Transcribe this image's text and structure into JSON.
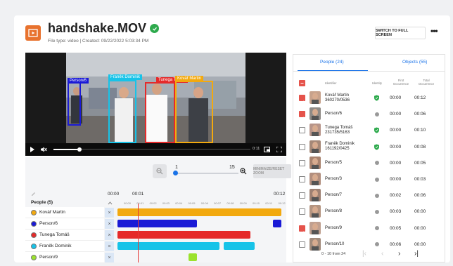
{
  "header": {
    "title": "handshake.MOV",
    "subtitle": "File type: video | Created: 09/22/2022 5:03:34 PM",
    "switch_label": "SWITCH TO FULL SCREEN",
    "more_icon": "more-icon"
  },
  "video": {
    "boxes": [
      {
        "label": "Person/6",
        "color": "#1a1ad6"
      },
      {
        "label": "Franěk Dominik",
        "color": "#17c3e8"
      },
      {
        "label": "Tunega Tomáš",
        "color": "#e52a2a"
      },
      {
        "label": "Kovář Martin",
        "color": "#f2a90f"
      }
    ],
    "time_display": "0:11"
  },
  "timeline": {
    "zoom_min": "1",
    "zoom_max": "15",
    "reset_label": "MINIMAIZE/RESET ZOOM",
    "start_time": "00:00",
    "playhead_time": "00:01",
    "end_time": "00:12",
    "section_label": "People (5)",
    "ticks": [
      "00:00",
      "00:01",
      "00:02",
      "00:03",
      "00:04",
      "00:05",
      "00:06",
      "00:07",
      "00:08",
      "00:09",
      "00:10",
      "00:11",
      "00:12"
    ],
    "rows": [
      {
        "name": "Kovář Martin",
        "color": "#f2a90f"
      },
      {
        "name": "Person/6",
        "color": "#1a1ad6"
      },
      {
        "name": "Tunega Tomáš",
        "color": "#e52a2a"
      },
      {
        "name": "Franěk Dominik",
        "color": "#17c3e8"
      },
      {
        "name": "Person/9",
        "color": "#9be22d"
      }
    ]
  },
  "panel": {
    "tabs": [
      "People (24)",
      "Objects (55)"
    ],
    "columns": [
      "Identifier",
      "Identity",
      "First Occurrence",
      "Total Occurrence"
    ],
    "rows": [
      {
        "id": "Kovář Martin 360270/0536",
        "identity": "verified",
        "first": "00:00",
        "total": "00:12",
        "checked": true
      },
      {
        "id": "Person/6",
        "identity": "unknown",
        "first": "00:00",
        "total": "00:06",
        "checked": true
      },
      {
        "id": "Tunega Tomáš 231735/5163",
        "identity": "verified",
        "first": "00:00",
        "total": "00:10",
        "checked": false
      },
      {
        "id": "Franěk Dominik 161192/0425",
        "identity": "verified",
        "first": "00:00",
        "total": "00:08",
        "checked": false
      },
      {
        "id": "Person/5",
        "identity": "unknown",
        "first": "00:00",
        "total": "00:05",
        "checked": false
      },
      {
        "id": "Person/3",
        "identity": "unknown",
        "first": "00:00",
        "total": "00:03",
        "checked": false
      },
      {
        "id": "Person/7",
        "identity": "unknown",
        "first": "00:02",
        "total": "00:06",
        "checked": false
      },
      {
        "id": "Person/8",
        "identity": "unknown",
        "first": "00:03",
        "total": "00:00",
        "checked": false
      },
      {
        "id": "Person/9",
        "identity": "unknown",
        "first": "00:05",
        "total": "00:00",
        "checked": true
      },
      {
        "id": "Person/10",
        "identity": "unknown",
        "first": "00:06",
        "total": "00:00",
        "checked": false
      }
    ],
    "pager_text": "0 - 10 from 24"
  },
  "colors": {
    "accent": "#1a73e8",
    "verified": "#2eaa4d",
    "checkbox_on": "#e5534b"
  }
}
